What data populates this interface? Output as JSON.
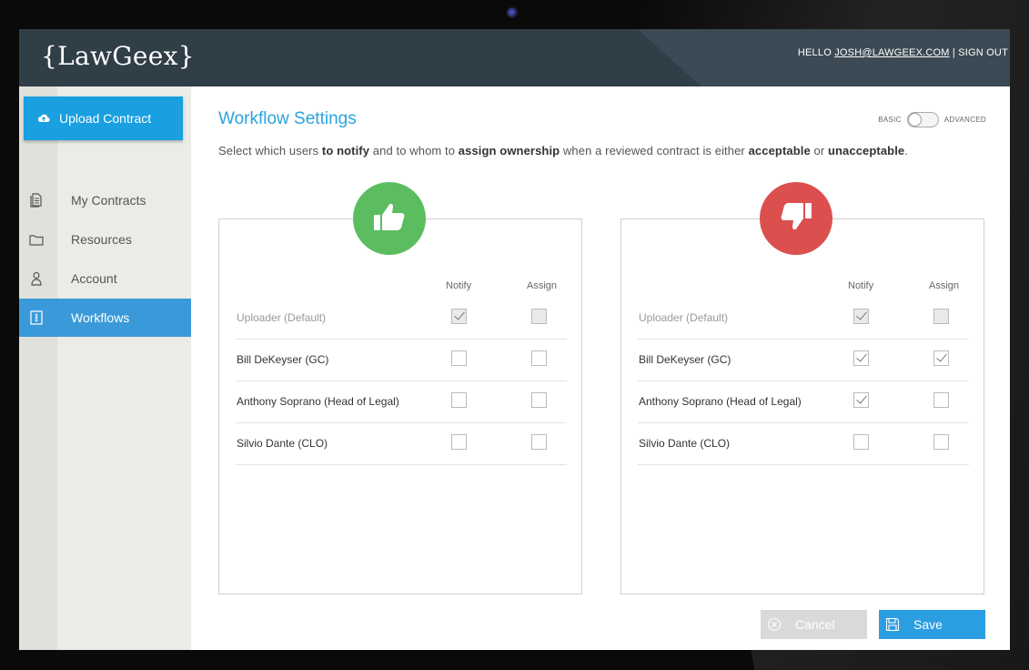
{
  "app": {
    "logo": "{LawGeex}"
  },
  "header": {
    "hello": "HELLO ",
    "email": "JOSH@LAWGEEX.COM",
    "separator": " | ",
    "signout": "SIGN OUT"
  },
  "sidebar": {
    "upload_label": "Upload Contract",
    "items": [
      {
        "label": "My Contracts",
        "icon": "document-icon"
      },
      {
        "label": "Resources",
        "icon": "folder-icon"
      },
      {
        "label": "Account",
        "icon": "user-icon"
      },
      {
        "label": "Workflows",
        "icon": "workflow-icon",
        "active": true
      }
    ]
  },
  "main": {
    "title": "Workflow Settings",
    "mode": {
      "basic": "BASIC",
      "advanced": "ADVANCED",
      "selected": "BASIC"
    },
    "desc": {
      "p1": "Select which users ",
      "b1": "to notify",
      "p2": " and to whom to ",
      "b2": "assign ownership",
      "p3": " when a reviewed contract is either ",
      "b3": "acceptable",
      "p4": " or ",
      "b4": "unacceptable",
      "p5": "."
    },
    "columns": {
      "notify": "Notify",
      "assign": "Assign"
    },
    "acceptable": {
      "icon": "thumbs-up-icon",
      "rows": [
        {
          "name": "Uploader (Default)",
          "notify": true,
          "assign": false,
          "default": true
        },
        {
          "name": "Bill DeKeyser (GC)",
          "notify": false,
          "assign": false
        },
        {
          "name": "Anthony Soprano (Head of Legal)",
          "notify": false,
          "assign": false
        },
        {
          "name": "Silvio Dante (CLO)",
          "notify": false,
          "assign": false
        }
      ]
    },
    "unacceptable": {
      "icon": "thumbs-down-icon",
      "rows": [
        {
          "name": "Uploader (Default)",
          "notify": true,
          "assign": false,
          "default": true
        },
        {
          "name": "Bill DeKeyser (GC)",
          "notify": true,
          "assign": true
        },
        {
          "name": "Anthony Soprano (Head of Legal)",
          "notify": true,
          "assign": false
        },
        {
          "name": "Silvio Dante (CLO)",
          "notify": false,
          "assign": false
        }
      ]
    },
    "buttons": {
      "cancel": "Cancel",
      "save": "Save"
    }
  },
  "colors": {
    "accent": "#2aa3dd",
    "header": "#303e48",
    "good": "#5bbd5f",
    "bad": "#dc4f4f"
  }
}
